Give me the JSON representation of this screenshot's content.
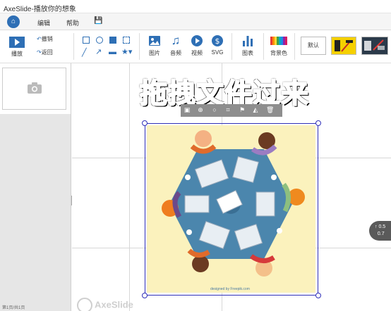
{
  "window": {
    "title": "AxeSlide-播放你的想象"
  },
  "menu": {
    "items": [
      "编辑",
      "帮助"
    ]
  },
  "toolbar": {
    "play_label": "播放",
    "undo_label": "撤销",
    "redo_label": "返回",
    "image_label": "图片",
    "audio_label": "音频",
    "video_label": "视频",
    "svg_label": "SVG",
    "chart_label": "图表",
    "background_label": "背景色",
    "default_label": "默认",
    "accent": "#2e6fb5"
  },
  "canvas": {
    "headline": "拖拽文件过来",
    "image_credit": "designed by Freepik.com",
    "watermark": "AxeSlide"
  },
  "zoom": {
    "line1": "0.5",
    "line2": "0.7"
  },
  "status": {
    "text": "第1页/共1页"
  }
}
